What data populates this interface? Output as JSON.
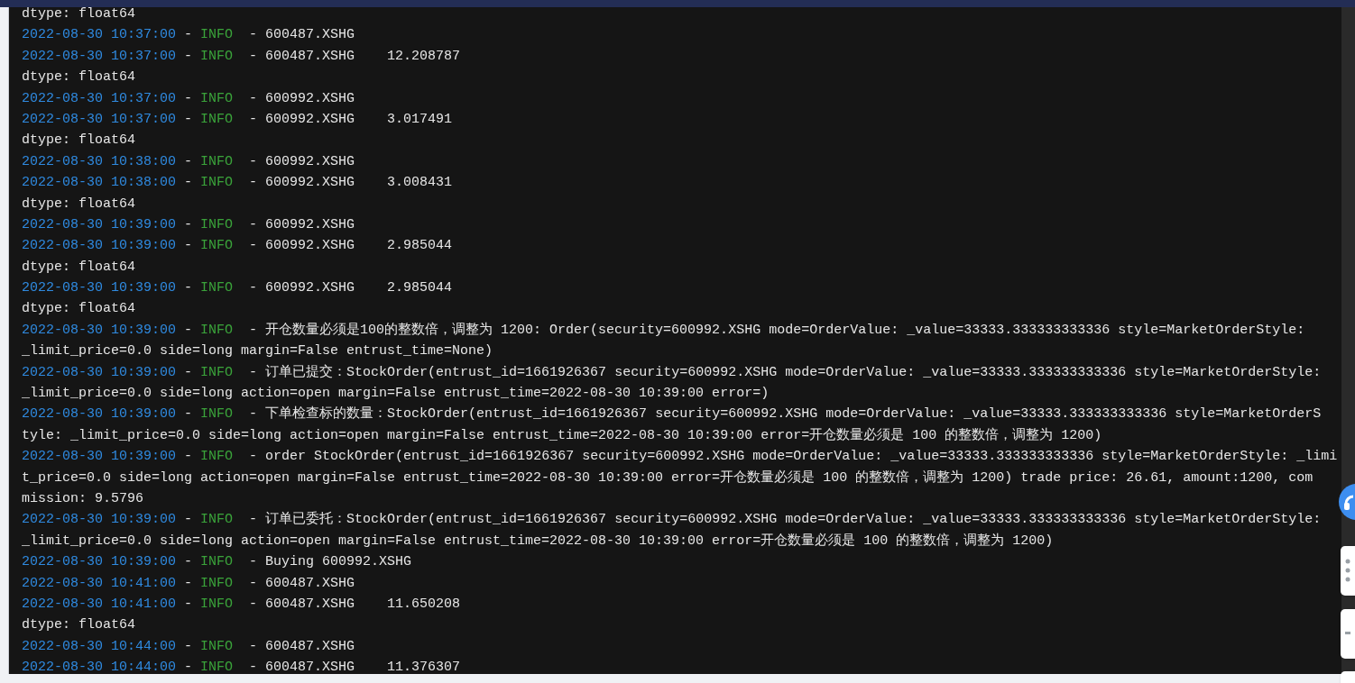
{
  "log": [
    {
      "kind": "plain",
      "text": "dtype: float64"
    },
    {
      "kind": "log",
      "time": "2022-08-30 10:37:00",
      "separators": [
        "-",
        "-"
      ],
      "level": "INFO",
      "message": "600487.XSHG"
    },
    {
      "kind": "log",
      "time": "2022-08-30 10:37:00",
      "separators": [
        "-",
        "-"
      ],
      "level": "INFO",
      "message": "600487.XSHG    12.208787"
    },
    {
      "kind": "plain",
      "text": "dtype: float64"
    },
    {
      "kind": "log",
      "time": "2022-08-30 10:37:00",
      "separators": [
        "-",
        "-"
      ],
      "level": "INFO",
      "message": "600992.XSHG"
    },
    {
      "kind": "log",
      "time": "2022-08-30 10:37:00",
      "separators": [
        "-",
        "-"
      ],
      "level": "INFO",
      "message": "600992.XSHG    3.017491"
    },
    {
      "kind": "plain",
      "text": "dtype: float64"
    },
    {
      "kind": "log",
      "time": "2022-08-30 10:38:00",
      "separators": [
        "-",
        "-"
      ],
      "level": "INFO",
      "message": "600992.XSHG"
    },
    {
      "kind": "log",
      "time": "2022-08-30 10:38:00",
      "separators": [
        "-",
        "-"
      ],
      "level": "INFO",
      "message": "600992.XSHG    3.008431"
    },
    {
      "kind": "plain",
      "text": "dtype: float64"
    },
    {
      "kind": "log",
      "time": "2022-08-30 10:39:00",
      "separators": [
        "-",
        "-"
      ],
      "level": "INFO",
      "message": "600992.XSHG"
    },
    {
      "kind": "log",
      "time": "2022-08-30 10:39:00",
      "separators": [
        "-",
        "-"
      ],
      "level": "INFO",
      "message": "600992.XSHG    2.985044"
    },
    {
      "kind": "plain",
      "text": "dtype: float64"
    },
    {
      "kind": "log",
      "time": "2022-08-30 10:39:00",
      "separators": [
        "-",
        "-"
      ],
      "level": "INFO",
      "message": "600992.XSHG    2.985044"
    },
    {
      "kind": "plain",
      "text": "dtype: float64"
    },
    {
      "kind": "log",
      "time": "2022-08-30 10:39:00",
      "separators": [
        "-",
        "-"
      ],
      "level": "INFO",
      "message": "开仓数量必须是100的整数倍，调整为 1200: Order(security=600992.XSHG mode=OrderValue: _value=33333.333333333336 style=MarketOrderStyle:",
      "wrapped": [
        "_limit_price=0.0 side=long margin=False entrust_time=None)"
      ]
    },
    {
      "kind": "log",
      "time": "2022-08-30 10:39:00",
      "separators": [
        "-",
        "-"
      ],
      "level": "INFO",
      "message": "订单已提交：StockOrder(entrust_id=1661926367 security=600992.XSHG mode=OrderValue: _value=33333.333333333336 style=MarketOrderStyle:",
      "wrapped": [
        "_limit_price=0.0 side=long action=open margin=False entrust_time=2022-08-30 10:39:00 error=)"
      ]
    },
    {
      "kind": "log",
      "time": "2022-08-30 10:39:00",
      "separators": [
        "-",
        "-"
      ],
      "level": "INFO",
      "message": "下单检查标的数量：StockOrder(entrust_id=1661926367 security=600992.XSHG mode=OrderValue: _value=33333.333333333336 style=MarketOrderS",
      "wrapped": [
        "tyle: _limit_price=0.0 side=long action=open margin=False entrust_time=2022-08-30 10:39:00 error=开仓数量必须是 100 的整数倍，调整为 1200)"
      ]
    },
    {
      "kind": "log",
      "time": "2022-08-30 10:39:00",
      "separators": [
        "-",
        "-"
      ],
      "level": "INFO",
      "message": "order StockOrder(entrust_id=1661926367 security=600992.XSHG mode=OrderValue: _value=33333.333333333336 style=MarketOrderStyle: _limi",
      "wrapped": [
        "t_price=0.0 side=long action=open margin=False entrust_time=2022-08-30 10:39:00 error=开仓数量必须是 100 的整数倍，调整为 1200) trade price: 26.61, amount:1200, com",
        "mission: 9.5796"
      ]
    },
    {
      "kind": "log",
      "time": "2022-08-30 10:39:00",
      "separators": [
        "-",
        "-"
      ],
      "level": "INFO",
      "message": "订单已委托：StockOrder(entrust_id=1661926367 security=600992.XSHG mode=OrderValue: _value=33333.333333333336 style=MarketOrderStyle:",
      "wrapped": [
        "_limit_price=0.0 side=long action=open margin=False entrust_time=2022-08-30 10:39:00 error=开仓数量必须是 100 的整数倍，调整为 1200)"
      ]
    },
    {
      "kind": "log",
      "time": "2022-08-30 10:39:00",
      "separators": [
        "-",
        "-"
      ],
      "level": "INFO",
      "message": "Buying 600992.XSHG"
    },
    {
      "kind": "log",
      "time": "2022-08-30 10:41:00",
      "separators": [
        "-",
        "-"
      ],
      "level": "INFO",
      "message": "600487.XSHG"
    },
    {
      "kind": "log",
      "time": "2022-08-30 10:41:00",
      "separators": [
        "-",
        "-"
      ],
      "level": "INFO",
      "message": "600487.XSHG    11.650208"
    },
    {
      "kind": "plain",
      "text": "dtype: float64"
    },
    {
      "kind": "log",
      "time": "2022-08-30 10:44:00",
      "separators": [
        "-",
        "-"
      ],
      "level": "INFO",
      "message": "600487.XSHG"
    },
    {
      "kind": "log",
      "time": "2022-08-30 10:44:00",
      "separators": [
        "-",
        "-"
      ],
      "level": "INFO",
      "message": "600487.XSHG    11.376307"
    }
  ]
}
